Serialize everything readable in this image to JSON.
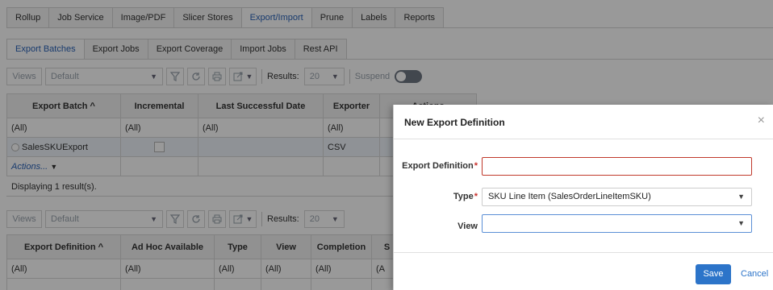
{
  "main_tabs": [
    "Rollup",
    "Job Service",
    "Image/PDF",
    "Slicer Stores",
    "Export/Import",
    "Prune",
    "Labels",
    "Reports"
  ],
  "main_active": "Export/Import",
  "sub_tabs": [
    "Export Batches",
    "Export Jobs",
    "Export Coverage",
    "Import Jobs",
    "Rest API"
  ],
  "sub_active": "Export Batches",
  "toolbar1": {
    "views": "Views",
    "view_value": "Default",
    "results_label": "Results:",
    "results_value": "20",
    "suspend": "Suspend"
  },
  "grid1": {
    "headers": [
      "Export Batch ^",
      "Incremental",
      "Last Successful Date",
      "Exporter",
      "Actions"
    ],
    "filters": [
      "(All)",
      "(All)",
      "(All)",
      "(All)",
      ""
    ],
    "row": {
      "batch": "SalesSKUExport",
      "exporter": "CSV"
    },
    "actions": "Actions...",
    "status": "Displaying 1 result(s)."
  },
  "toolbar2": {
    "views": "Views",
    "view_value": "Default",
    "results_label": "Results:",
    "results_value": "20"
  },
  "grid2": {
    "headers": [
      "Export Definition ^",
      "Ad Hoc Available",
      "Type",
      "View",
      "Completion",
      "S"
    ],
    "filters": [
      "(All)",
      "(All)",
      "(All)",
      "(All)",
      "(All)",
      "(A"
    ]
  },
  "modal": {
    "title": "New Export Definition",
    "close": "×",
    "def_label": "Export Definition",
    "def_value": "",
    "type_label": "Type",
    "type_value": "SKU Line Item (SalesOrderLineItemSKU)",
    "view_label": "View",
    "view_value": "",
    "required_mark": "*",
    "save": "Save",
    "cancel": "Cancel"
  },
  "colors": {
    "accent": "#2c74c9",
    "error": "#c0392b",
    "tab_active_text": "#2a63b8"
  }
}
